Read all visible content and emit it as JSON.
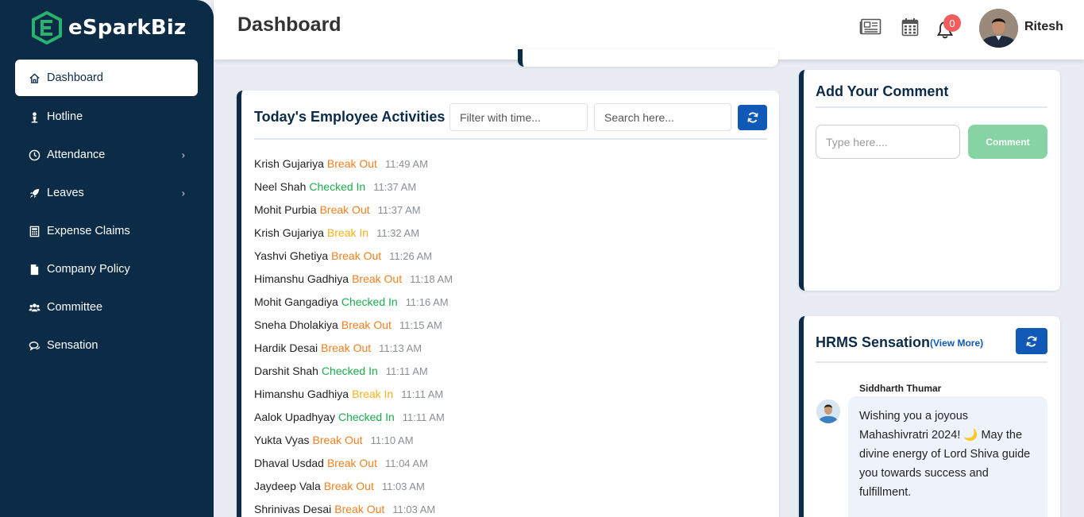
{
  "brand": {
    "name": "eSparkBiz",
    "accent": "#27b36b",
    "sidebar_bg": "#0c2b47"
  },
  "sidebar": {
    "items": [
      {
        "label": "Dashboard",
        "icon": "home-icon",
        "active": true
      },
      {
        "label": "Hotline",
        "icon": "person-icon"
      },
      {
        "label": "Attendance",
        "icon": "clock-icon",
        "has_submenu": true
      },
      {
        "label": "Leaves",
        "icon": "rocket-icon",
        "has_submenu": true
      },
      {
        "label": "Expense Claims",
        "icon": "calculator-icon"
      },
      {
        "label": "Company Policy",
        "icon": "file-icon"
      },
      {
        "label": "Committee",
        "icon": "users-icon"
      },
      {
        "label": "Sensation",
        "icon": "comments-icon"
      }
    ],
    "caret": "›"
  },
  "header": {
    "title": "Dashboard",
    "notification_count": "0",
    "user_name": "Ritesh"
  },
  "activities": {
    "title": "Today's Employee Activities",
    "filter_placeholder": "Filter with time...",
    "search_placeholder": "Search here...",
    "items": [
      {
        "name": "Krish Gujariya",
        "status": "Break Out",
        "type": "out",
        "time": "11:49 AM"
      },
      {
        "name": "Neel Shah",
        "status": "Checked In",
        "type": "checked",
        "time": "11:37 AM"
      },
      {
        "name": "Mohit Purbia",
        "status": "Break Out",
        "type": "out",
        "time": "11:37 AM"
      },
      {
        "name": "Krish Gujariya",
        "status": "Break In",
        "type": "in",
        "time": "11:32 AM"
      },
      {
        "name": "Yashvi Ghetiya",
        "status": "Break Out",
        "type": "out",
        "time": "11:26 AM"
      },
      {
        "name": "Himanshu Gadhiya",
        "status": "Break Out",
        "type": "out",
        "time": "11:18 AM"
      },
      {
        "name": "Mohit Gangadiya",
        "status": "Checked In",
        "type": "checked",
        "time": "11:16 AM"
      },
      {
        "name": "Sneha Dholakiya",
        "status": "Break Out",
        "type": "out",
        "time": "11:15 AM"
      },
      {
        "name": "Hardik Desai",
        "status": "Break Out",
        "type": "out",
        "time": "11:13 AM"
      },
      {
        "name": "Darshit Shah",
        "status": "Checked In",
        "type": "checked",
        "time": "11:11 AM"
      },
      {
        "name": "Himanshu Gadhiya",
        "status": "Break In",
        "type": "in",
        "time": "11:11 AM"
      },
      {
        "name": "Aalok Upadhyay",
        "status": "Checked In",
        "type": "checked",
        "time": "11:11 AM"
      },
      {
        "name": "Yukta Vyas",
        "status": "Break Out",
        "type": "out",
        "time": "11:10 AM"
      },
      {
        "name": "Dhaval Usdad",
        "status": "Break Out",
        "type": "out",
        "time": "11:04 AM"
      },
      {
        "name": "Jaydeep Vala",
        "status": "Break Out",
        "type": "out",
        "time": "11:03 AM"
      },
      {
        "name": "Shrinivas Desai",
        "status": "Break Out",
        "type": "out",
        "time": "11:03 AM"
      }
    ],
    "status_colors": {
      "out": "#f07f1f",
      "in": "#f5b21b",
      "checked": "#1cad4d"
    }
  },
  "comment": {
    "title": "Add Your Comment",
    "placeholder": "Type here....",
    "button_label": "Comment"
  },
  "sensation": {
    "title": "HRMS Sensation",
    "view_more": "(View More)",
    "post": {
      "author": "Siddharth Thumar",
      "text": "Wishing you a joyous Mahashivratri 2024! 🌙 May the divine energy of Lord Shiva guide you towards success and fulfillment."
    }
  }
}
